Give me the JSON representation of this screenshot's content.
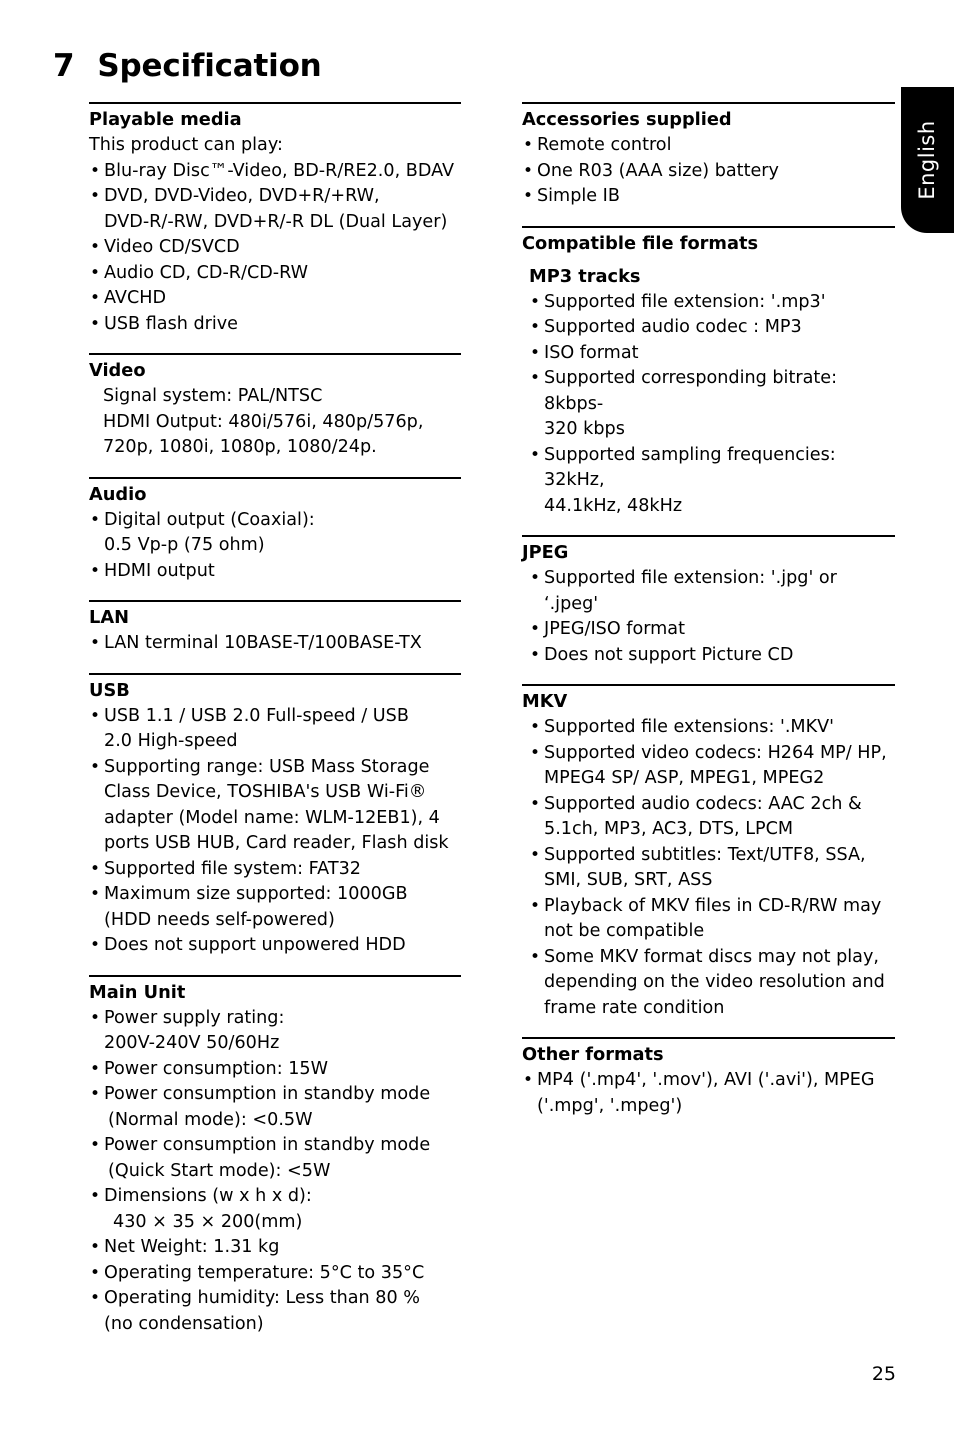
{
  "language_tab": {
    "label": "English"
  },
  "chapter": {
    "number": "7",
    "title": "Specification"
  },
  "page_number": "25",
  "left_column": {
    "playable_media": {
      "heading": "Playable media",
      "intro": "This product can play:",
      "items": [
        {
          "line1": "Blu-ray Disc™-Video, BD-R/RE2.0, BDAV"
        },
        {
          "line1": "DVD, DVD-Video, DVD+R/+RW,",
          "line2": "DVD-R/-RW, DVD+R/-R DL (Dual Layer)"
        },
        {
          "line1": "Video CD/SVCD"
        },
        {
          "line1": "Audio CD, CD-R/CD-RW"
        },
        {
          "line1": "AVCHD"
        },
        {
          "line1": "USB flash drive"
        }
      ]
    },
    "video": {
      "heading": "Video",
      "lines": [
        "Signal system: PAL/NTSC",
        "HDMI Output: 480i/576i, 480p/576p,",
        "720p, 1080i, 1080p, 1080/24p."
      ]
    },
    "audio": {
      "heading": "Audio",
      "items": [
        {
          "line1": "Digital output (Coaxial):",
          "line2": "0.5 Vp-p (75 ohm)"
        },
        {
          "line1": "HDMI output"
        }
      ]
    },
    "lan": {
      "heading": "LAN",
      "items": [
        {
          "line1": "LAN terminal 10BASE-T/100BASE-TX"
        }
      ]
    },
    "usb": {
      "heading": "USB",
      "items": [
        {
          "line1": "USB 1.1 / USB 2.0 Full-speed / USB",
          "line2": "2.0 High-speed"
        },
        {
          "line1": "Supporting range: USB Mass Storage",
          "line2": "Class Device, TOSHIBA's USB Wi-Fi®",
          "line3": "adapter (Model name: WLM-12EB1), 4",
          "line4": "ports USB HUB, Card reader, Flash disk"
        },
        {
          "line1": "Supported file system: FAT32"
        },
        {
          "line1": "Maximum size supported: 1000GB",
          "line2": "(HDD needs self-powered)"
        },
        {
          "line1": "Does not support unpowered HDD"
        }
      ]
    },
    "main_unit": {
      "heading": "Main Unit",
      "items": [
        {
          "line1": "Power supply rating:",
          "line2": "200V-240V 50/60Hz"
        },
        {
          "line1": "Power consumption: 15W"
        },
        {
          "line1": "Power consumption in standby mode",
          "line2": "(Normal mode): <0.5W"
        },
        {
          "line1": "Power consumption in standby mode",
          "line2": "(Quick Start mode): <5W"
        },
        {
          "line1": "Dimensions (w x h x d):",
          "line2": "430 × 35 × 200(mm)"
        },
        {
          "line1": "Net Weight: 1.31 kg"
        },
        {
          "line1": "Operating temperature: 5°C to 35°C"
        },
        {
          "line1": "Operating humidity: Less than 80 %",
          "line2": "(no condensation)"
        }
      ]
    }
  },
  "right_column": {
    "accessories": {
      "heading": "Accessories supplied",
      "items": [
        {
          "line1": "Remote control"
        },
        {
          "line1": "One R03 (AAA size) battery"
        },
        {
          "line1": "Simple IB"
        }
      ]
    },
    "compatible_formats": {
      "heading": "Compatible file formats",
      "mp3": {
        "heading": "MP3 tracks",
        "items": [
          {
            "line1": "Supported file extension: '.mp3'"
          },
          {
            "line1": "Supported audio codec : MP3"
          },
          {
            "line1": "ISO format"
          },
          {
            "line1": "Supported corresponding bitrate: 8kbps-",
            "line2": "320 kbps"
          },
          {
            "line1": "Supported sampling frequencies: 32kHz,",
            "line2": "44.1kHz, 48kHz"
          }
        ]
      }
    },
    "jpeg": {
      "heading": "JPEG",
      "items": [
        {
          "line1": "Supported file extension: '.jpg' or ‘.jpeg'"
        },
        {
          "line1": "JPEG/ISO format"
        },
        {
          "line1": "Does not support Picture CD"
        }
      ]
    },
    "mkv": {
      "heading": "MKV",
      "items": [
        {
          "line1": "Supported file extensions: '.MKV'"
        },
        {
          "line1": "Supported video codecs: H264 MP/ HP,",
          "line2": "MPEG4 SP/ ASP, MPEG1, MPEG2"
        },
        {
          "line1": "Supported audio codecs: AAC 2ch &",
          "line2": "5.1ch, MP3, AC3, DTS, LPCM"
        },
        {
          "line1": "Supported subtitles: Text/UTF8, SSA,",
          "line2": "SMI, SUB, SRT, ASS"
        },
        {
          "line1": "Playback of MKV files in CD-R/RW may",
          "line2": "not be compatible"
        },
        {
          "line1": "Some MKV format discs may not play,",
          "line2": "depending on the video resolution and",
          "line3": "frame rate condition"
        }
      ]
    },
    "other_formats": {
      "heading": "Other formats",
      "items": [
        {
          "line1": "MP4 ('.mp4', '.mov'), AVI ('.avi'), MPEG",
          "line2": "('.mpg', '.mpeg')"
        }
      ]
    }
  }
}
